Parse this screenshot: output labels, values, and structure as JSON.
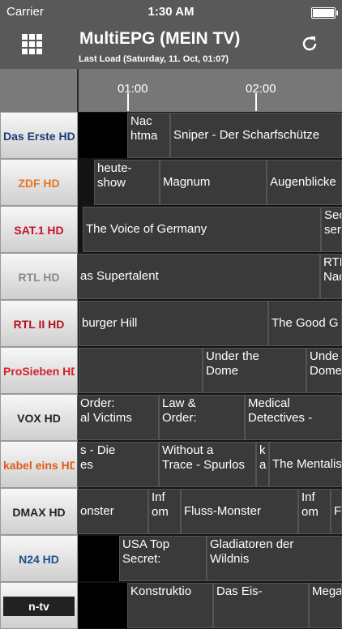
{
  "status": {
    "carrier": "Carrier",
    "time": "1:30 AM"
  },
  "nav": {
    "title": "MultiEPG (MEIN TV)",
    "subtitle": "Last Load (Saturday, 11. Oct, 01:07)"
  },
  "timeline": {
    "labels": [
      "01:00",
      "02:00"
    ]
  },
  "channels": [
    {
      "logo": "Das Erste HD",
      "programs": [
        "",
        "Nac\nhtma",
        "Sniper - Der Scharfschütze"
      ]
    },
    {
      "logo": "ZDF HD",
      "programs": [
        "heute-\nshow",
        "Magnum",
        "Augenblicke"
      ]
    },
    {
      "logo": "SAT.1 HD",
      "programs": [
        "The Voice of Germany",
        "Sec\nser"
      ]
    },
    {
      "logo": "RTL HD",
      "programs": [
        "as Supertalent",
        "RTL\nNac"
      ]
    },
    {
      "logo": "RTL II HD",
      "programs": [
        "burger Hill",
        "The Good G"
      ]
    },
    {
      "logo": "ProSieben HD",
      "programs": [
        "",
        "Under the\nDome",
        "Unde\nDome"
      ]
    },
    {
      "logo": "VOX HD",
      "programs": [
        "Order:\nal Victims",
        "Law &\nOrder:",
        "Medical\nDetectives -"
      ]
    },
    {
      "logo": "kabel eins HD",
      "programs": [
        "s - Die\nes",
        "Without a\nTrace - Spurlos",
        "k\na",
        "The Mentalis"
      ]
    },
    {
      "logo": "DMAX HD",
      "programs": [
        "onster",
        "Inf\nom",
        "Fluss-Monster",
        "Inf\nom",
        "Fl"
      ]
    },
    {
      "logo": "N24 HD",
      "programs": [
        "USA Top\nSecret:",
        "Gladiatoren der\nWildnis"
      ]
    },
    {
      "logo": "n-tv",
      "programs": [
        "Konstruktio",
        "Das Eis-",
        "Mega"
      ]
    }
  ]
}
